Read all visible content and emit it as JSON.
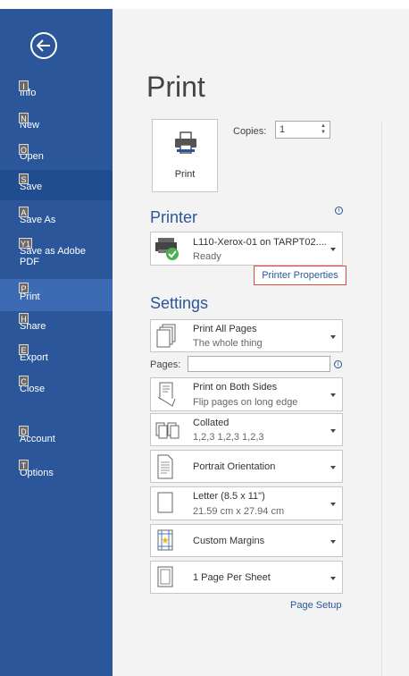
{
  "nav": {
    "items": [
      {
        "key": "I",
        "label": "Info"
      },
      {
        "key": "N",
        "label": "New"
      },
      {
        "key": "O",
        "label": "Open"
      },
      {
        "key": "S",
        "label": "Save"
      },
      {
        "key": "A",
        "label": "Save As"
      },
      {
        "key": "Y1",
        "label": "Save as Adobe PDF"
      },
      {
        "key": "P",
        "label": "Print"
      },
      {
        "key": "H",
        "label": "Share"
      },
      {
        "key": "E",
        "label": "Export"
      },
      {
        "key": "C",
        "label": "Close"
      },
      {
        "key": "D",
        "label": "Account"
      },
      {
        "key": "T",
        "label": "Options"
      }
    ]
  },
  "page": {
    "title": "Print"
  },
  "print": {
    "button_label": "Print",
    "copies_label": "Copies:",
    "copies_value": "1"
  },
  "printer": {
    "heading": "Printer",
    "info_icon": "i",
    "name": "L110-Xerox-01 on TARPT02....",
    "status": "Ready",
    "properties_link": "Printer Properties"
  },
  "settings": {
    "heading": "Settings",
    "what": {
      "main": "Print All Pages",
      "sub": "The whole thing"
    },
    "pages_label": "Pages:",
    "sides": {
      "main": "Print on Both Sides",
      "sub": "Flip pages on long edge"
    },
    "collation": {
      "main": "Collated",
      "sub": "1,2,3   1,2,3   1,2,3"
    },
    "orientation": {
      "main": "Portrait Orientation"
    },
    "paper": {
      "main": "Letter (8.5 x 11\")",
      "sub": "21.59 cm x 27.94 cm"
    },
    "margins": {
      "main": "Custom Margins"
    },
    "per_sheet": {
      "main": "1 Page Per Sheet"
    },
    "page_setup_link": "Page Setup"
  },
  "colors": {
    "accent": "#2b579a",
    "nav_bg": "#2b579a",
    "nav_active": "#3c6ab3",
    "link_border": "#e04a3f"
  }
}
